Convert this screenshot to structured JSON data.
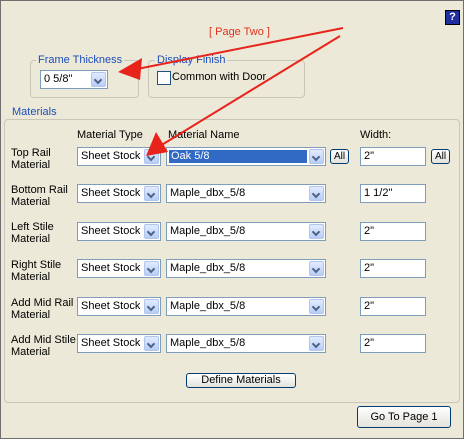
{
  "page_label": "[ Page Two ]",
  "help": "?",
  "frame_thickness": {
    "title": "Frame Thickness",
    "value": "0 5/8\""
  },
  "display_finish": {
    "title": "Display Finish",
    "checkbox_label": "Common with Door",
    "checked": false
  },
  "materials": {
    "title": "Materials",
    "col_type": "Material Type",
    "col_name": "Material Name",
    "col_width": "Width:",
    "all_label": "All",
    "rows": [
      {
        "label1": "Top Rail",
        "label2": "Material",
        "type": "Sheet Stock",
        "name": "Oak 5/8",
        "width": "2\""
      },
      {
        "label1": "Bottom Rail",
        "label2": "Material",
        "type": "Sheet Stock",
        "name": "Maple_dbx_5/8",
        "width": "1 1/2\""
      },
      {
        "label1": "Left Stile",
        "label2": "Material",
        "type": "Sheet Stock",
        "name": "Maple_dbx_5/8",
        "width": "2\""
      },
      {
        "label1": "Right Stile",
        "label2": "Material",
        "type": "Sheet Stock",
        "name": "Maple_dbx_5/8",
        "width": "2\""
      },
      {
        "label1": "Add Mid Rail",
        "label2": "Material",
        "type": "Sheet Stock",
        "name": "Maple_dbx_5/8",
        "width": "2\""
      },
      {
        "label1": "Add Mid Stile",
        "label2": "Material",
        "type": "Sheet Stock",
        "name": "Maple_dbx_5/8",
        "width": "2\""
      }
    ],
    "define_button": "Define Materials"
  },
  "goto_button": "Go To Page 1",
  "colors": {
    "accent_red": "#e8231b",
    "group_title": "#1c4fb8",
    "selection": "#316ac5"
  }
}
